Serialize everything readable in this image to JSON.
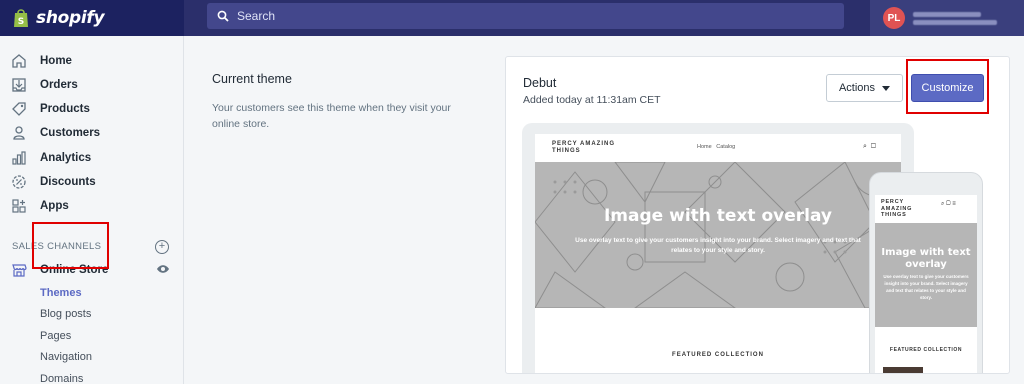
{
  "brand": {
    "name": "shopify"
  },
  "search": {
    "placeholder": "Search"
  },
  "user": {
    "initials": "PL"
  },
  "sidebar": {
    "items": [
      {
        "label": "Home",
        "icon": "home-icon"
      },
      {
        "label": "Orders",
        "icon": "orders-icon"
      },
      {
        "label": "Products",
        "icon": "tag-icon"
      },
      {
        "label": "Customers",
        "icon": "person-icon"
      },
      {
        "label": "Analytics",
        "icon": "bar-chart-icon"
      },
      {
        "label": "Discounts",
        "icon": "discount-icon"
      },
      {
        "label": "Apps",
        "icon": "apps-icon"
      }
    ],
    "sales_channels_title": "SALES CHANNELS",
    "online_store": "Online Store",
    "sub_items": [
      "Themes",
      "Blog posts",
      "Pages",
      "Navigation",
      "Domains"
    ]
  },
  "current_theme": {
    "title": "Current theme",
    "description": "Your customers see this theme when they visit your online store."
  },
  "theme_card": {
    "name": "Debut",
    "added": "Added today at 11:31am CET",
    "actions_label": "Actions",
    "customize_label": "Customize"
  },
  "preview": {
    "store_name": "PERCY AMAZING THINGS",
    "nav_home": "Home",
    "nav_catalog": "Catalog",
    "hero_title": "Image with text overlay",
    "hero_text": "Use overlay text to give your customers insight into your brand. Select imagery and text that relates to your style and story.",
    "featured": "FEATURED COLLECTION"
  },
  "colors": {
    "topbar": "#1c2260",
    "search_bg": "#43478c",
    "primary": "#5c6ac4",
    "highlight": "#e00000"
  }
}
